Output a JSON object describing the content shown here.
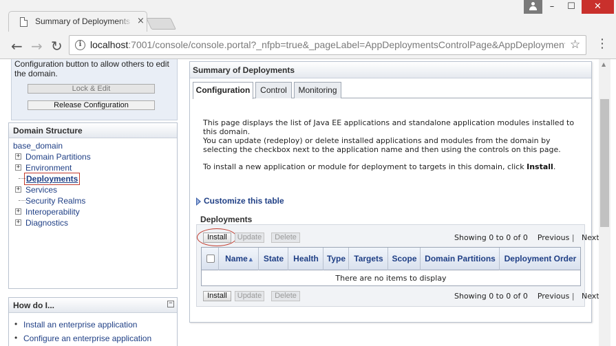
{
  "browser": {
    "tab_title": "Summary of Deployments",
    "tab_close": "×",
    "window": {
      "minimize": "–",
      "maximize": "☐",
      "close": "✕"
    },
    "nav": {
      "back": "←",
      "forward": "→",
      "reload": "↻"
    },
    "url_host": "localhost",
    "url_rest": ":7001/console/console.portal?_nfpb=true&_pageLabel=AppDeploymentsControlPage&AppDeployment",
    "star": "☆",
    "menu": "⋮"
  },
  "change_center": {
    "text": "Configuration button to allow others to edit the domain.",
    "lock_edit": "Lock & Edit",
    "release_configuration": "Release Configuration"
  },
  "domain_structure": {
    "title": "Domain Structure",
    "root": "base_domain",
    "items": [
      {
        "label": "Domain Partitions",
        "expandable": true,
        "exp": "+"
      },
      {
        "label": "Environment",
        "expandable": true,
        "exp": "+"
      },
      {
        "label": "Deployments",
        "expandable": false,
        "selected": true
      },
      {
        "label": "Services",
        "expandable": true,
        "exp": "+"
      },
      {
        "label": "Security Realms",
        "expandable": false
      },
      {
        "label": "Interoperability",
        "expandable": true,
        "exp": "+"
      },
      {
        "label": "Diagnostics",
        "expandable": true,
        "exp": "+"
      }
    ]
  },
  "how_do_i": {
    "title": "How do I...",
    "collapse": "−",
    "items": [
      "Install an enterprise application",
      "Configure an enterprise application"
    ]
  },
  "main": {
    "title": "Summary of Deployments",
    "tabs": [
      "Configuration",
      "Control",
      "Monitoring"
    ],
    "active_tab": "Configuration",
    "desc1": "This page displays the list of Java EE applications and standalone application modules installed to this domain.",
    "desc2": "You can update (redeploy) or delete installed applications and modules from the domain by selecting the checkbox next to the application name and then using the controls on this page.",
    "desc3_prefix": "To install a new application or module for deployment to targets in this domain, click ",
    "desc3_bold": "Install",
    "desc3_suffix": ".",
    "customize": "Customize this table"
  },
  "deployments": {
    "title": "Deployments",
    "buttons": {
      "install": "Install",
      "update": "Update",
      "delete": "Delete"
    },
    "pager": {
      "showing": "Showing 0 to 0 of 0",
      "previous": "Previous",
      "sep": "|",
      "next": "Next"
    },
    "columns": [
      "Name",
      "State",
      "Health",
      "Type",
      "Targets",
      "Scope",
      "Domain Partitions",
      "Deployment Order"
    ],
    "sort_icon": "⩓",
    "empty_message": "There are no items to display"
  },
  "colors": {
    "link": "#1f3f85",
    "highlight_red": "#c0392b",
    "window_close": "#c9302c"
  }
}
